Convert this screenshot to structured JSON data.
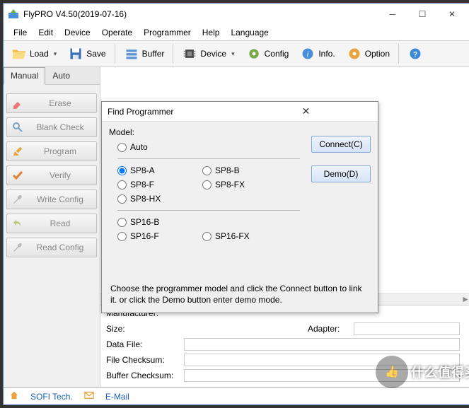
{
  "title": "FlyPRO V4.50(2019-07-16)",
  "menu": [
    "File",
    "Edit",
    "Device",
    "Operate",
    "Programmer",
    "Help",
    "Language"
  ],
  "toolbar": {
    "load": "Load",
    "save": "Save",
    "buffer": "Buffer",
    "device": "Device",
    "config": "Config",
    "info": "Info.",
    "option": "Option"
  },
  "tabs": {
    "manual": "Manual",
    "auto": "Auto"
  },
  "ops": {
    "erase": "Erase",
    "blank": "Blank Check",
    "program": "Program",
    "verify": "Verify",
    "writecfg": "Write Config",
    "read": "Read",
    "readcfg": "Read Config"
  },
  "info": {
    "manu": "Manufacturer:",
    "size": "Size:",
    "adapter": "Adapter:",
    "datafile": "Data File:",
    "fchk": "File Checksum:",
    "bchk": "Buffer Checksum:"
  },
  "status": {
    "co": "SOFI Tech.",
    "email": "E-Mail"
  },
  "dialog": {
    "title": "Find Programmer",
    "model": "Model:",
    "auto": "Auto",
    "sp8a": "SP8-A",
    "sp8b": "SP8-B",
    "sp8f": "SP8-F",
    "sp8fx": "SP8-FX",
    "sp8hx": "SP8-HX",
    "sp16b": "SP16-B",
    "sp16f": "SP16-F",
    "sp16fx": "SP16-FX",
    "connect": "Connect(C)",
    "demo": "Demo(D)",
    "hint": "Choose the programmer model and click the Connect button to link it. or click the Demo button enter demo mode."
  },
  "watermark": "什么值得买"
}
